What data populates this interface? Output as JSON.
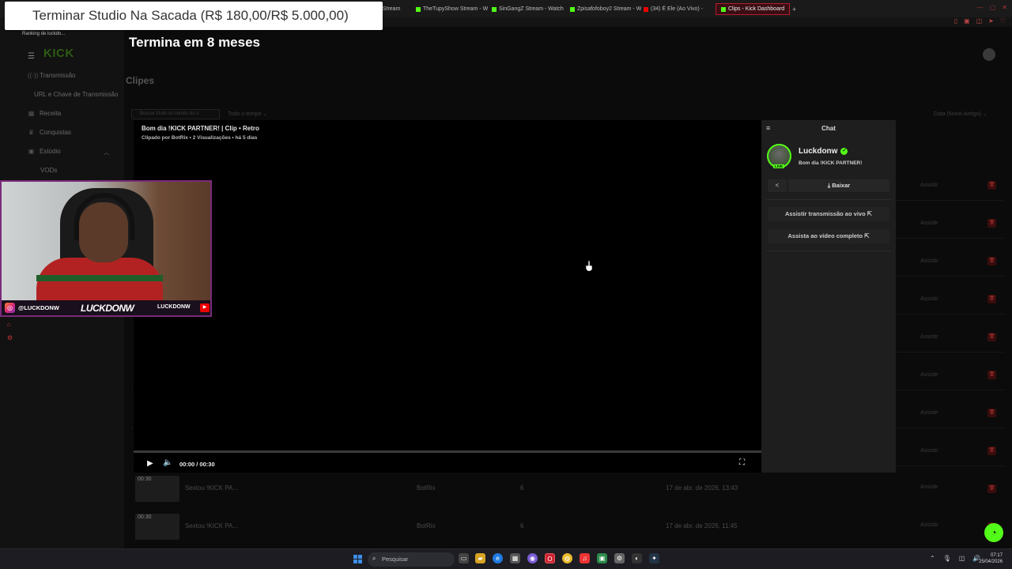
{
  "browser": {
    "tabs": [
      {
        "label": "o Stream"
      },
      {
        "label": "TheTupyShow Stream - W"
      },
      {
        "label": "SinGangZ Stream - Watch"
      },
      {
        "label": "Zpisafofoboy2 Stream - W"
      },
      {
        "label": "(34) É Ele (Ao Vivo) -"
      },
      {
        "label": "Clips - Kick Dashboard"
      }
    ],
    "new_tab": "+"
  },
  "overlay": {
    "goal_text": "Terminar Studio Na Sacada (R$ 180,00/R$ 5.000,00)",
    "goal_sub": "Termina em 8 meses",
    "ranking": "Ranking de luckdo..."
  },
  "sidebar": {
    "logo": "KICK",
    "items": [
      {
        "label": "Transmissão",
        "icon": "broadcast-icon"
      },
      {
        "label": "URL e Chave de Transmissão",
        "icon": ""
      },
      {
        "label": "Receita",
        "icon": "revenue-icon"
      },
      {
        "label": "Conquistas",
        "icon": "trophy-icon"
      },
      {
        "label": "Estúdio",
        "icon": "studio-icon"
      },
      {
        "label": "VODs",
        "icon": ""
      }
    ]
  },
  "dashboard": {
    "title": "Clipes",
    "search_placeholder": "Buscar título ou nomes do u",
    "time_filter": "Todo o tempo",
    "sort": "Data (Novo-Antigo)",
    "watch_label": "Assistir",
    "rows": [
      {
        "duration": "00:30",
        "title": "Sextou !KICK PA...",
        "author": "BotRix",
        "views": "6",
        "date": "17 de abr. de 2026, 13:43"
      },
      {
        "duration": "00:30",
        "title": "Sextou !KICK PA...",
        "author": "BotRix",
        "views": "6",
        "date": "17 de abr. de 2026, 11:45"
      }
    ]
  },
  "player": {
    "title": "Bom dia !KICK PARTNER! | Clip • Retro",
    "meta": "Clipado por BotRix • 2 Visualizações • há 5 dias",
    "time": "00:00 / 00:30",
    "progress": 0
  },
  "panel": {
    "header": "Chat",
    "streamer_name": "Luckdonw",
    "stream_title": "Bom dia !KICK PARTNER!",
    "live_badge": "LIVE",
    "download": "Baixar",
    "watch_live": "Assistir transmissão ao vivo",
    "watch_full": "Assista ao vídeo completo"
  },
  "webcam": {
    "instagram_handle": "@LUCKDONW",
    "name": "LUCKDONW",
    "youtube_handle": "LUCKDONW"
  },
  "taskbar": {
    "search": "Pesquisar",
    "time": "07:17",
    "date": "25/04/2026"
  },
  "colors": {
    "kick_green": "#53fc18",
    "accent_red": "#b31b2f",
    "background": "#0b0b0b"
  }
}
